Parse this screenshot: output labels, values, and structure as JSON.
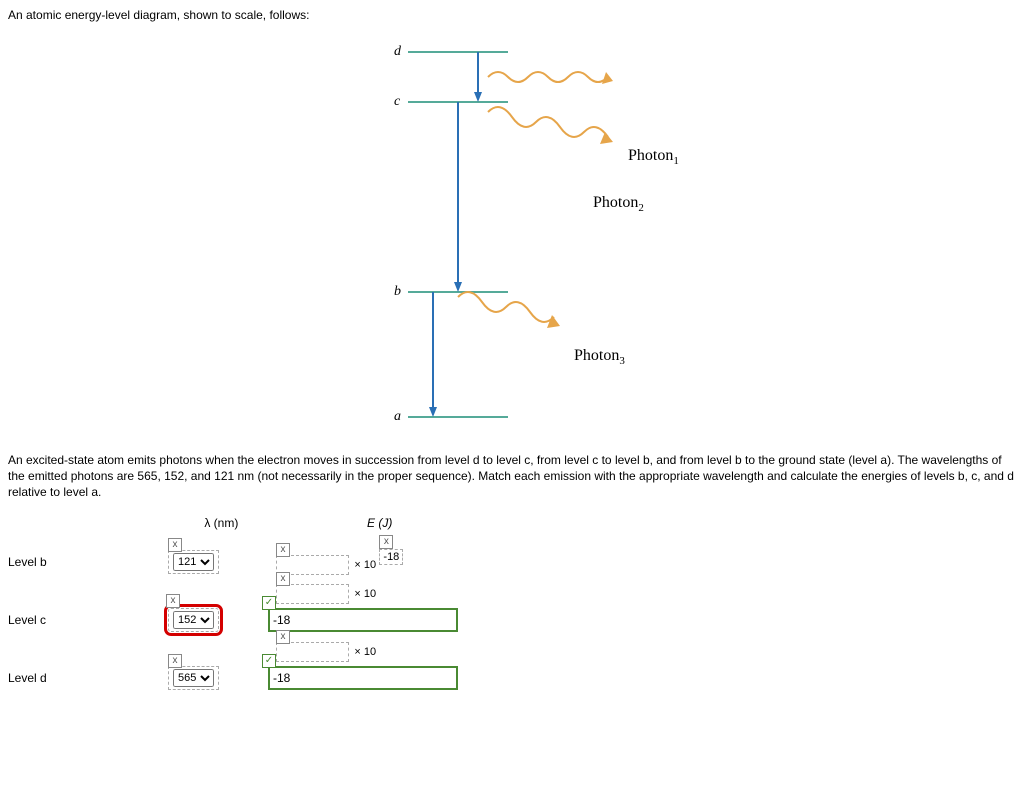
{
  "intro_text": "An atomic energy-level diagram, shown to scale, follows:",
  "description": "An excited-state atom emits photons when the electron moves in succession from level d to level c, from level c to level b, and from level b to the ground state (level a). The wavelengths of the emitted photons are 565, 152, and 121 nm (not necessarily in the proper sequence). Match each emission with the appropriate wavelength and calculate the energies of levels b, c, and d relative to level a.",
  "diagram": {
    "levels": {
      "d": "d",
      "c": "c",
      "b": "b",
      "a": "a"
    },
    "photons": {
      "p1": "Photon",
      "p1_sub": "1",
      "p2": "Photon",
      "p2_sub": "2",
      "p3": "Photon",
      "p3_sub": "3"
    }
  },
  "headers": {
    "lambda": "λ (nm)",
    "energy": "E (J)"
  },
  "rows": {
    "b": {
      "label": "Level b",
      "lambda_selected": "121",
      "lambda_status": "x",
      "e_coef_status": "x",
      "e_coef_value": "",
      "e_times": "× 10",
      "e_exp_value": "-18",
      "e_exp_status": "x"
    },
    "c": {
      "label": "Level c",
      "lambda_selected": "152",
      "lambda_status": "x",
      "e_coef_status": "check",
      "e_coef_value": "-18",
      "exp_box_status": "x",
      "exp_box_value": "",
      "exp_times": "× 10",
      "big_input_value": ""
    },
    "d": {
      "label": "Level d",
      "lambda_selected": "565",
      "lambda_status": "x",
      "e_coef_status": "check",
      "e_coef_value": "-18",
      "exp_box_status": "x",
      "exp_box_value": "",
      "exp_times": "× 10",
      "big_input_value": ""
    }
  },
  "select_options": [
    "121",
    "152",
    "565"
  ],
  "marks": {
    "x": "x",
    "check": "✓"
  }
}
